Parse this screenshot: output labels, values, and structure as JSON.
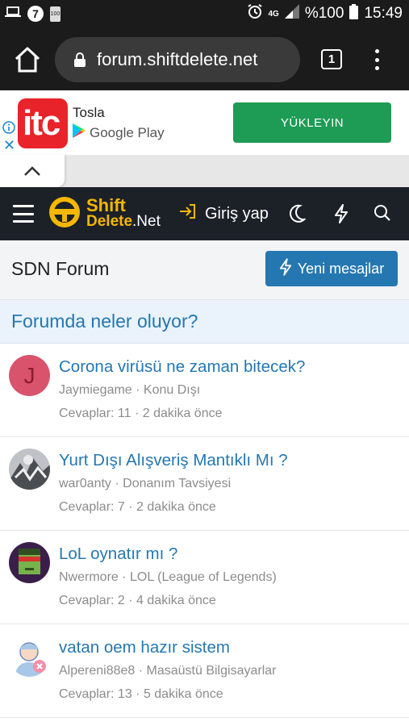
{
  "status_bar": {
    "notif_badge": "7",
    "battery_small": "100",
    "network": "4G",
    "battery": "%100",
    "time": "15:49"
  },
  "browser": {
    "url": "forum.shiftdelete.net",
    "tab_count": "1"
  },
  "ad": {
    "logo_text": "itc",
    "app_name": "Tosla",
    "store": "Google Play",
    "cta": "YÜKLEYIN",
    "close": "✕"
  },
  "header": {
    "logo_line1": "Shift",
    "logo_line2a": "Delete",
    "logo_line2b": ".Net",
    "login_label": "Giriş yap",
    "brand_color": "#f5b700"
  },
  "page": {
    "title": "SDN Forum",
    "new_messages_label": "Yeni mesajlar",
    "section_title": "Forumda neler oluyor?"
  },
  "threads": [
    {
      "title": "Corona virüsü ne zaman bitecek?",
      "author": "Jaymiegame",
      "forum": "Konu Dışı",
      "replies": "Cevaplar: 11",
      "time": "2 dakika önce",
      "avatar_letter": "J"
    },
    {
      "title": "Yurt Dışı Alışveriş Mantıklı Mı ?",
      "author": "war0anty",
      "forum": "Donanım Tavsiyesi",
      "replies": "Cevaplar: 7",
      "time": "2 dakika önce",
      "avatar_letter": ""
    },
    {
      "title": "LoL oynatır mı ?",
      "author": "Nwermore",
      "forum": "LOL (League of Legends)",
      "replies": "Cevaplar: 2",
      "time": "4 dakika önce",
      "avatar_letter": ""
    },
    {
      "title": "vatan oem hazır sistem",
      "author": "Alpereni88e8",
      "forum": "Masaüstü Bilgisayarlar",
      "replies": "Cevaplar: 13",
      "time": "5 dakika önce",
      "avatar_letter": ""
    }
  ],
  "separator": " · "
}
